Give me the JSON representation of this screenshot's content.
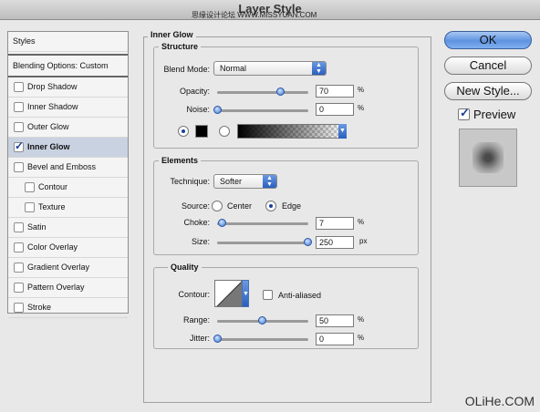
{
  "window": {
    "title": "Layer Style",
    "watermark_top": "思缘设计论坛 WWW.MISSYUAN.COM",
    "watermark_bottom": "OLiHe.COM"
  },
  "sidebar": {
    "header": "Styles",
    "blending": "Blending Options: Custom",
    "items": [
      {
        "label": "Drop Shadow",
        "checked": false
      },
      {
        "label": "Inner Shadow",
        "checked": false
      },
      {
        "label": "Outer Glow",
        "checked": false
      },
      {
        "label": "Inner Glow",
        "checked": true
      },
      {
        "label": "Bevel and Emboss",
        "checked": false
      },
      {
        "label": "Contour",
        "checked": false
      },
      {
        "label": "Texture",
        "checked": false
      },
      {
        "label": "Satin",
        "checked": false
      },
      {
        "label": "Color Overlay",
        "checked": false
      },
      {
        "label": "Gradient Overlay",
        "checked": false
      },
      {
        "label": "Pattern Overlay",
        "checked": false
      },
      {
        "label": "Stroke",
        "checked": false
      }
    ]
  },
  "panel": {
    "title": "Inner Glow",
    "structure": {
      "label": "Structure",
      "blend_mode_label": "Blend Mode:",
      "blend_mode": "Normal",
      "opacity_label": "Opacity:",
      "opacity": "70",
      "opacity_unit": "%",
      "noise_label": "Noise:",
      "noise": "0",
      "noise_unit": "%",
      "glow_color": "#000000"
    },
    "elements": {
      "label": "Elements",
      "technique_label": "Technique:",
      "technique": "Softer",
      "source_label": "Source:",
      "source_center": "Center",
      "source_edge": "Edge",
      "choke_label": "Choke:",
      "choke": "7",
      "choke_unit": "%",
      "size_label": "Size:",
      "size": "250",
      "size_unit": "px"
    },
    "quality": {
      "label": "Quality",
      "contour_label": "Contour:",
      "anti_aliased": "Anti-aliased",
      "range_label": "Range:",
      "range": "50",
      "range_unit": "%",
      "jitter_label": "Jitter:",
      "jitter": "0",
      "jitter_unit": "%"
    }
  },
  "buttons": {
    "ok": "OK",
    "cancel": "Cancel",
    "new_style": "New Style...",
    "preview": "Preview"
  },
  "colors": {
    "accent": "#3b78d4",
    "selected_row": "#c9d2e1"
  }
}
